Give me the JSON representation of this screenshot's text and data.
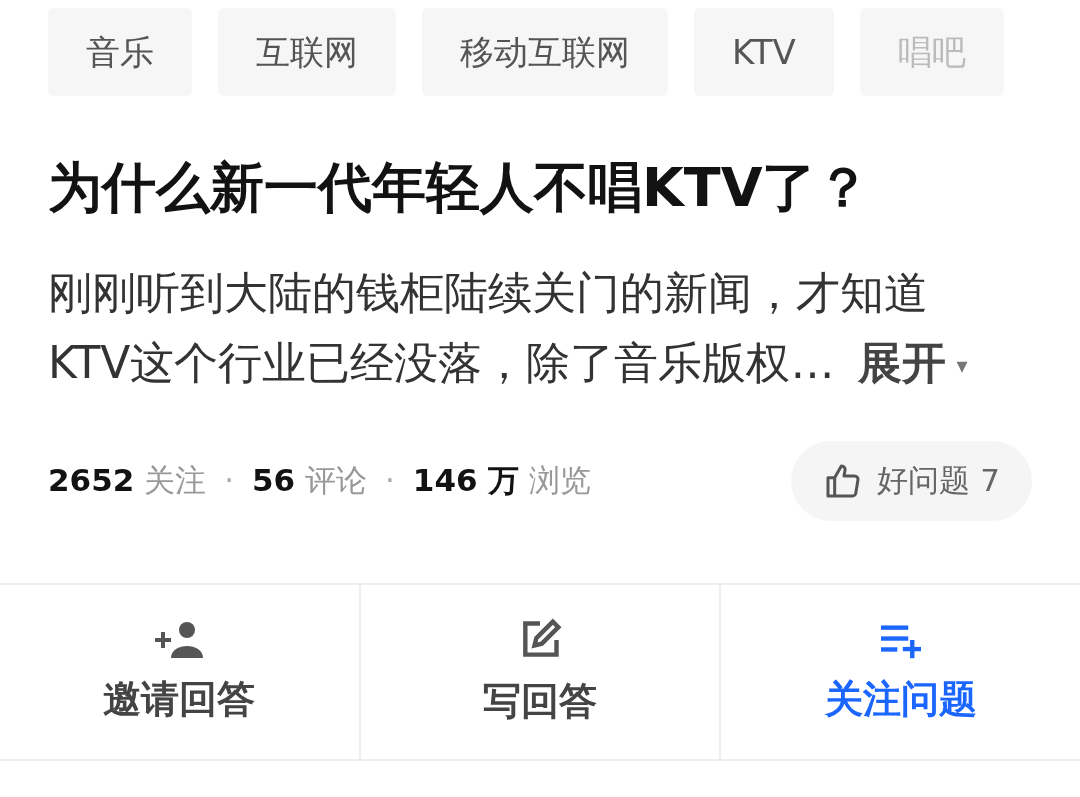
{
  "topics": [
    {
      "label": "音乐",
      "faded": false
    },
    {
      "label": "互联网",
      "faded": false
    },
    {
      "label": "移动互联网",
      "faded": false
    },
    {
      "label": "KTV",
      "faded": false
    },
    {
      "label": "唱吧",
      "faded": true
    }
  ],
  "question": {
    "title": "为什么新一代年轻人不唱KTV了？",
    "excerpt": "刚刚听到大陆的钱柜陆续关门的新闻，才知道KTV这个行业已经没落，除了音乐版权…",
    "expand": "展开",
    "expand_caret": "▾"
  },
  "stats": [
    {
      "count": "2652",
      "unit": "关注"
    },
    {
      "count": "56",
      "unit": "评论"
    },
    {
      "count": "146 万",
      "unit": "浏览"
    }
  ],
  "separator": "·",
  "good_question": {
    "label": "好问题 7"
  },
  "actions": [
    {
      "kind": "invite",
      "label": "邀请回答",
      "active": false
    },
    {
      "kind": "write",
      "label": "写回答",
      "active": false
    },
    {
      "kind": "follow",
      "label": "关注问题",
      "active": true
    }
  ]
}
